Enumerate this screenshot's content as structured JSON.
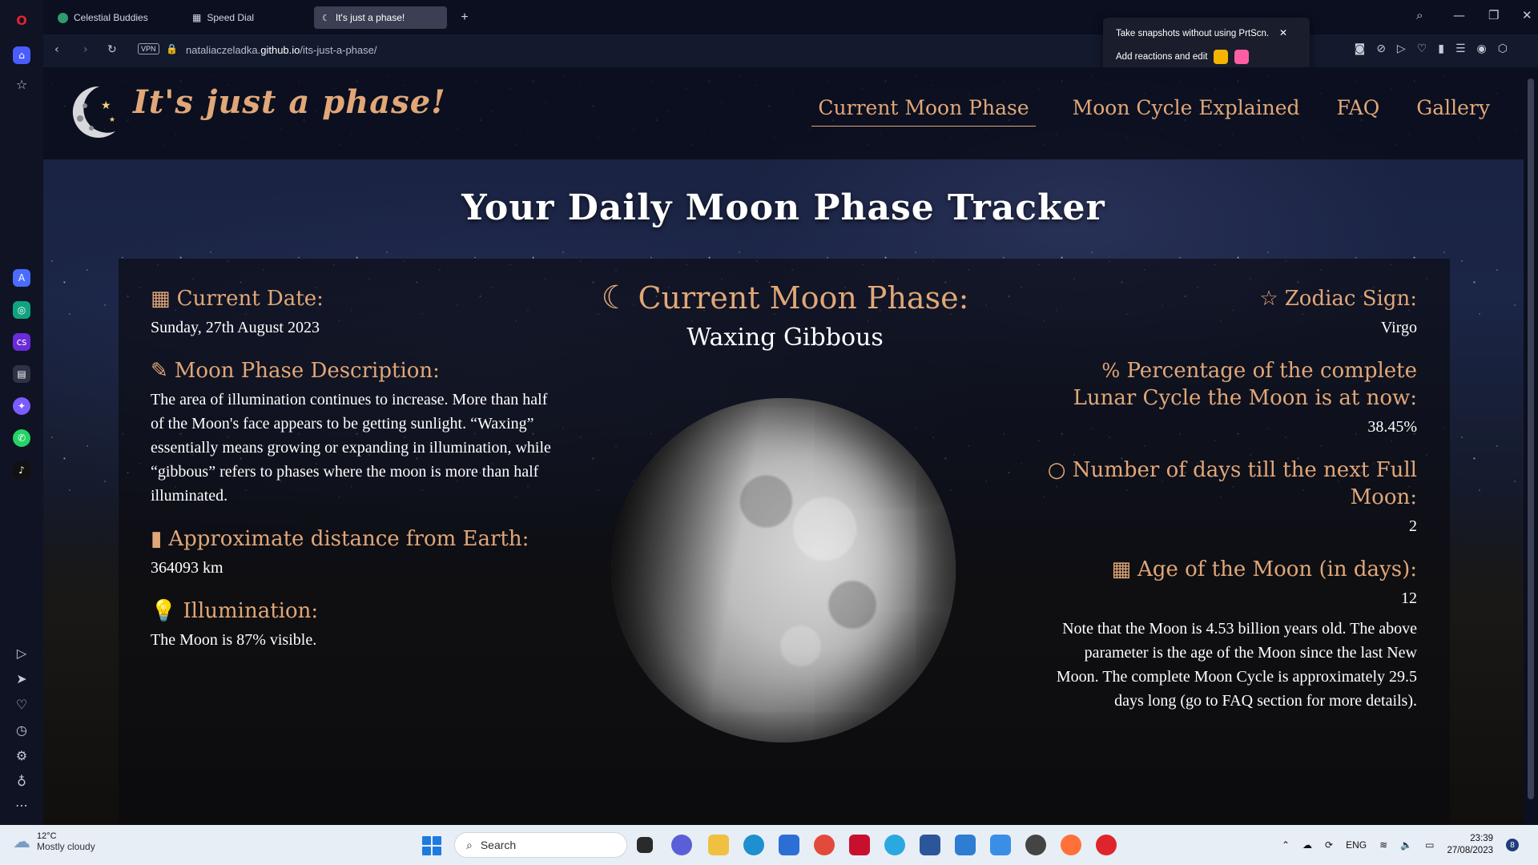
{
  "browser": {
    "tabs": [
      {
        "label": "Celestial Buddies",
        "active": false
      },
      {
        "label": "Speed Dial",
        "active": false
      },
      {
        "label": "It's just a phase!",
        "active": true
      }
    ],
    "vpn_label": "VPN",
    "url_prefix": "nataliaczeladka.",
    "url_host": "github.io",
    "url_path": "/its-just-a-phase/",
    "snapshot_popup": {
      "line1": "Take snapshots without using PrtScn.",
      "line2": "Add reactions and edit"
    }
  },
  "site": {
    "title": "It's just a phase!",
    "nav": [
      {
        "label": "Current Moon Phase",
        "active": true
      },
      {
        "label": "Moon Cycle Explained",
        "active": false
      },
      {
        "label": "FAQ",
        "active": false
      },
      {
        "label": "Gallery",
        "active": false
      }
    ],
    "hero_title": "Your Daily Moon Phase Tracker"
  },
  "tracker": {
    "current_date": {
      "heading": "Current Date:",
      "value": "Sunday, 27th August 2023",
      "icon": "calendar-icon"
    },
    "description": {
      "heading": "Moon Phase Description:",
      "value": "The area of illumination continues to increase. More than half of the Moon's face appears to be getting sunlight. “Waxing” essentially means growing or expanding in illumination, while “gibbous” refers to phases where the moon is more than half illuminated.",
      "icon": "edit-icon"
    },
    "distance": {
      "heading": "Approximate distance from Earth:",
      "value": "364093 km",
      "icon": "ruler-icon"
    },
    "illumination": {
      "heading": "Illumination:",
      "value": "The Moon is 87% visible.",
      "icon": "lightbulb-icon"
    },
    "phase": {
      "heading": "Current Moon Phase:",
      "value": "Waxing Gibbous",
      "icon": "crescent-moon-icon"
    },
    "zodiac": {
      "heading": "Zodiac Sign:",
      "value": "Virgo",
      "icon": "star-icon"
    },
    "percentage": {
      "heading": "Percentage of the complete Lunar Cycle the Moon is at now:",
      "value": "38.45%",
      "icon": "percent-icon"
    },
    "days_to_full": {
      "heading": "Number of days till the next Full Moon:",
      "value": "2",
      "icon": "circle-icon"
    },
    "age": {
      "heading": "Age of the Moon (in days):",
      "value": "12",
      "icon": "calendar-icon"
    },
    "age_note": "Note that the Moon is 4.53 billion years old. The above parameter is the age of the Moon since the last New Moon. The complete Moon Cycle is approximately 29.5 days long (go to FAQ section for more details)."
  },
  "taskbar": {
    "weather_temp": "12°C",
    "weather_cond": "Mostly cloudy",
    "search_placeholder": "Search",
    "lang": "ENG",
    "time": "23:39",
    "date": "27/08/2023",
    "notif_count": "8"
  },
  "colors": {
    "accent": "#e1a778",
    "text": "#ffffff",
    "panel": "#0a0a0e"
  }
}
